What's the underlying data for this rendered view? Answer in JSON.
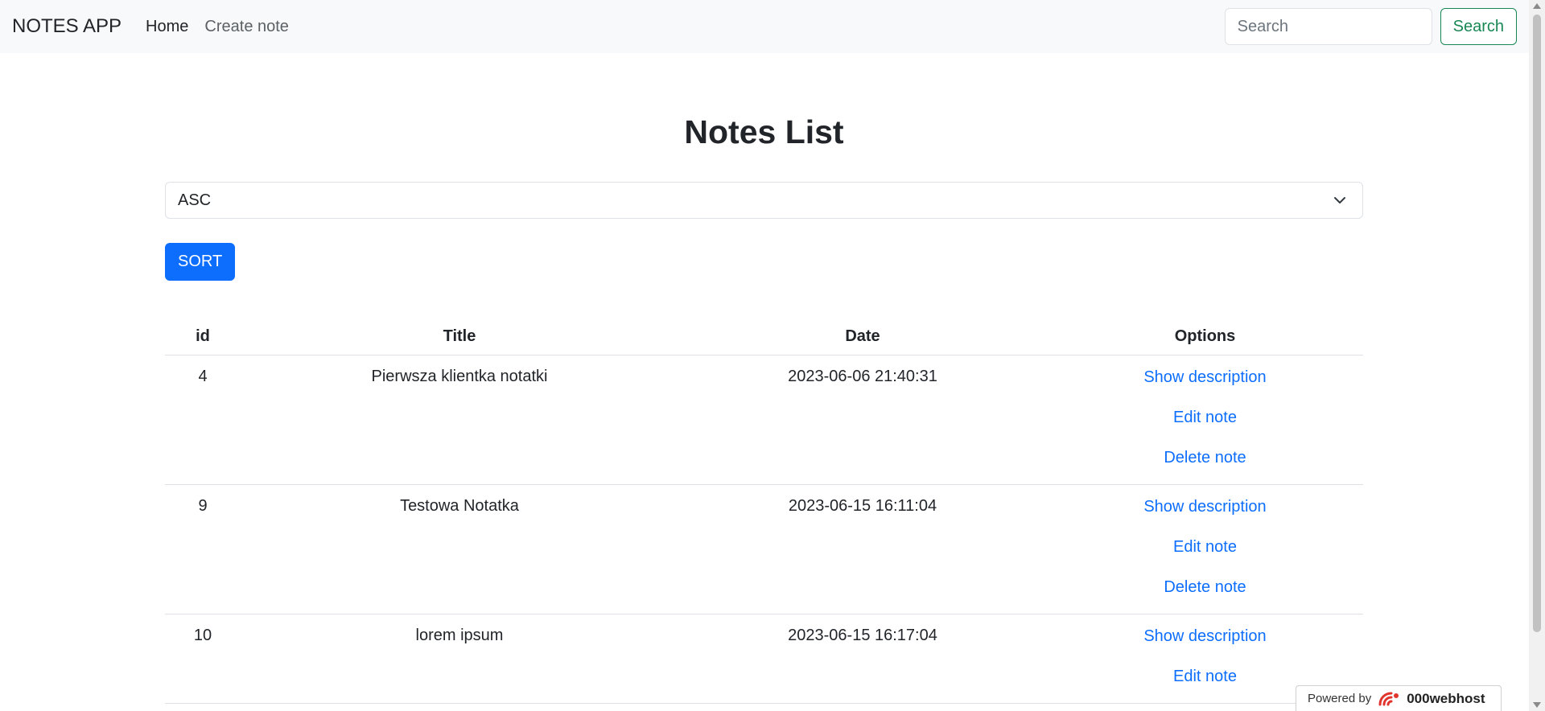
{
  "navbar": {
    "brand": "NOTES APP",
    "links": [
      "Home",
      "Create note"
    ],
    "search_placeholder": "Search",
    "search_button": "Search"
  },
  "main": {
    "title": "Notes List",
    "sort_select": {
      "selected": "ASC"
    },
    "sort_button": "SORT",
    "table": {
      "headers": [
        "id",
        "Title",
        "Date",
        "Options"
      ],
      "rows": [
        {
          "id": "4",
          "title": "Pierwsza klientka notatki",
          "date": "2023-06-06 21:40:31",
          "options": [
            "Show description",
            "Edit note",
            "Delete note"
          ]
        },
        {
          "id": "9",
          "title": "Testowa Notatka",
          "date": "2023-06-15 16:11:04",
          "options": [
            "Show description",
            "Edit note",
            "Delete note"
          ]
        },
        {
          "id": "10",
          "title": "lorem ipsum",
          "date": "2023-06-15 16:17:04",
          "options": [
            "Show description",
            "Edit note"
          ]
        }
      ]
    }
  },
  "footer_badge": {
    "powered_by": "Powered by",
    "brand": "000webhost",
    "logo_color": "#e0342c"
  },
  "colors": {
    "primary": "#0d6efd",
    "success": "#198754",
    "navbar_bg": "#f8f9fa",
    "text": "#212529"
  }
}
